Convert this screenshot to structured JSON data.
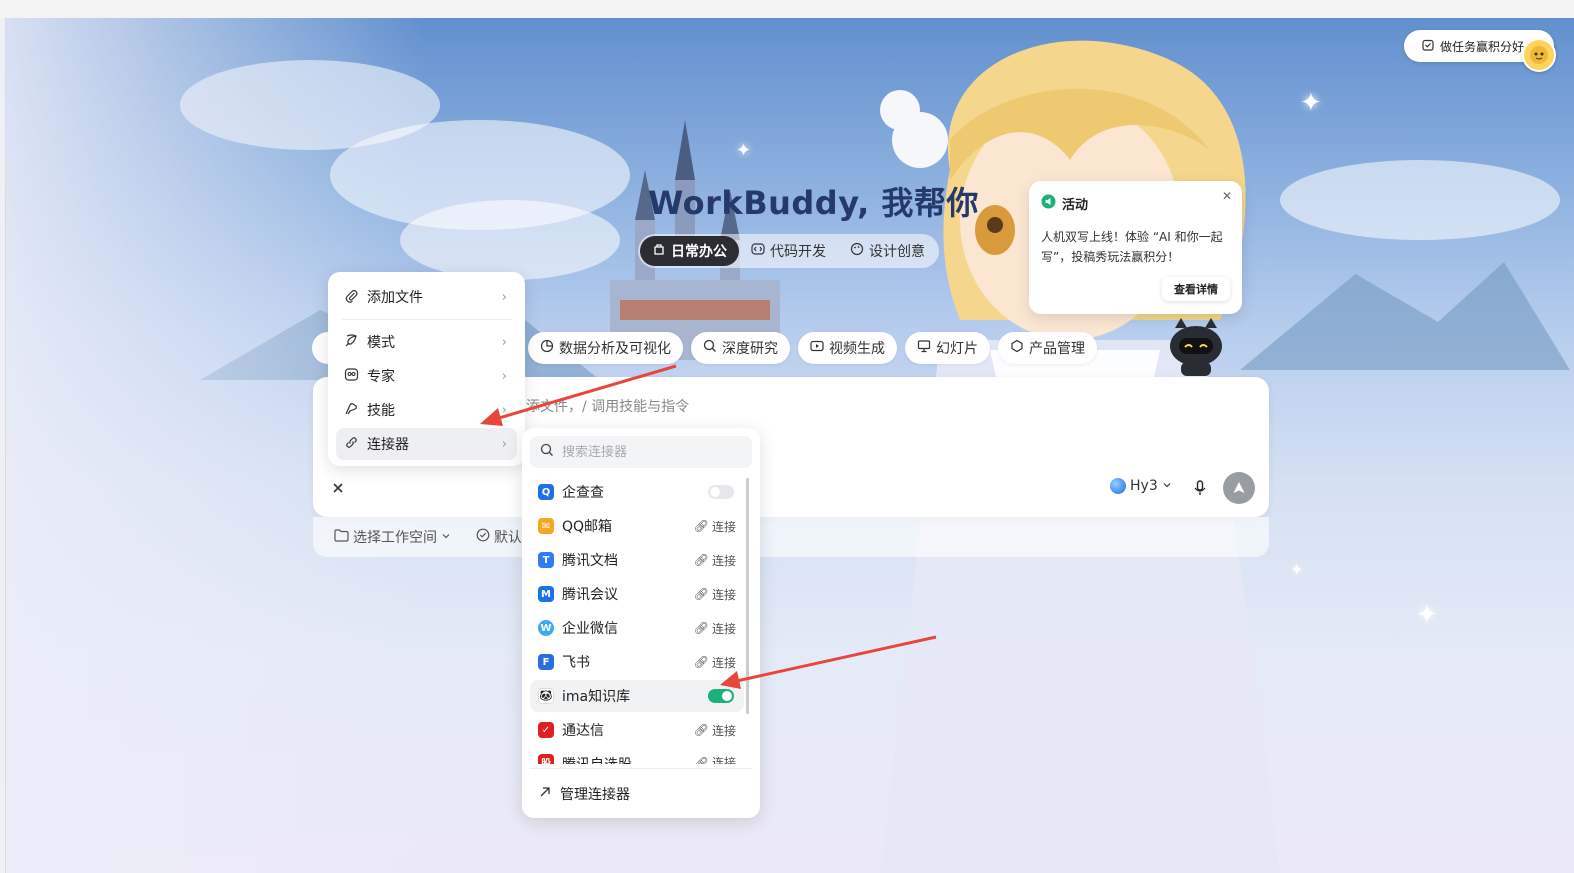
{
  "app": {
    "title": "WorkBuddy, 我帮你"
  },
  "task_button": {
    "label": "做任务赢积分好"
  },
  "mode_tabs": [
    {
      "label": "日常办公",
      "icon": "office-icon",
      "active": true
    },
    {
      "label": "代码开发",
      "icon": "code-icon",
      "active": false
    },
    {
      "label": "设计创意",
      "icon": "palette-icon",
      "active": false
    }
  ],
  "chips": [
    {
      "label": "数据分析及可视化",
      "icon": "pie-chart-icon"
    },
    {
      "label": "深度研究",
      "icon": "search-icon"
    },
    {
      "label": "视频生成",
      "icon": "video-icon"
    },
    {
      "label": "幻灯片",
      "icon": "slides-icon"
    },
    {
      "label": "产品管理",
      "icon": "product-icon"
    }
  ],
  "input": {
    "placeholder_visible": "添文件，/ 调用技能与指令"
  },
  "model": {
    "name": "Hy3"
  },
  "bottom": {
    "workspace": "选择工作空间",
    "default": "默认"
  },
  "menu": {
    "items": [
      {
        "label": "添加文件",
        "icon": "paperclip-icon"
      },
      {
        "label": "模式",
        "icon": "mode-icon"
      },
      {
        "label": "专家",
        "icon": "expert-icon"
      },
      {
        "label": "技能",
        "icon": "skill-icon"
      },
      {
        "label": "连接器",
        "icon": "link-icon"
      }
    ]
  },
  "connectors": {
    "search_placeholder": "搜索连接器",
    "connect_label": "连接",
    "items": [
      {
        "label": "企查查",
        "state": "toggle-off",
        "color": "#1e6fe8"
      },
      {
        "label": "QQ邮箱",
        "state": "connect",
        "color": "#f5a623"
      },
      {
        "label": "腾讯文档",
        "state": "connect",
        "color": "#2f7cf6"
      },
      {
        "label": "腾讯会议",
        "state": "connect",
        "color": "#1a73e8"
      },
      {
        "label": "企业微信",
        "state": "connect",
        "color": "#3fa9f5"
      },
      {
        "label": "飞书",
        "state": "connect",
        "color": "#2b6de0"
      },
      {
        "label": "ima知识库",
        "state": "toggle-on",
        "color": "#ffffff"
      },
      {
        "label": "通达信",
        "state": "connect",
        "color": "#e02020"
      },
      {
        "label": "腾讯自选股",
        "state": "connect",
        "color": "#e02020"
      }
    ],
    "manage_label": "管理连接器"
  },
  "popup": {
    "title": "活动",
    "body": "人机双写上线！体验 “AI 和你一起写”，投稿秀玩法赢积分！",
    "button": "查看详情"
  },
  "colors": {
    "accent_green": "#19b27b",
    "title_blue": "#253a6b",
    "arrow_red": "#e8453c"
  }
}
